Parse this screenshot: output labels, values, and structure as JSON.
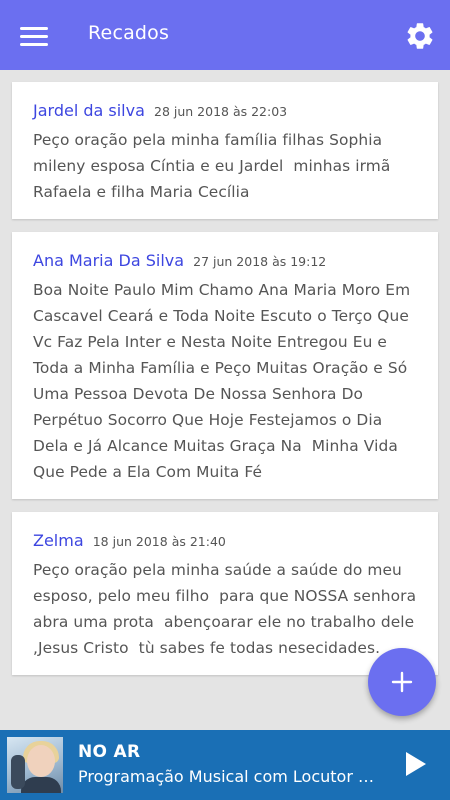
{
  "app_bar": {
    "title": "Recados",
    "menu_icon": "hamburger-menu-icon",
    "settings_icon": "gear-icon"
  },
  "messages": [
    {
      "author": "Jardel da silva",
      "date": "28 jun 2018 às 22:03",
      "text": "Peço oração pela minha família filhas Sophia mileny esposa Cíntia e eu Jardel  minhas irmã Rafaela e filha Maria Cecília"
    },
    {
      "author": "Ana Maria Da Silva",
      "date": "27 jun 2018 às 19:12",
      "text": "Boa Noite Paulo Mim Chamo Ana Maria Moro Em Cascavel Ceará e Toda Noite Escuto o Terço Que Vc Faz Pela Inter e Nesta Noite Entregou Eu e Toda a Minha Família e Peço Muitas Oração e Só Uma Pessoa Devota De Nossa Senhora Do Perpétuo Socorro Que Hoje Festejamos o Dia Dela e Já Alcance Muitas Graça Na  Minha Vida Que Pede a Ela Com Muita Fé"
    },
    {
      "author": "Zelma",
      "date": "18 jun 2018 às 21:40",
      "text": "Peço oração pela minha saúde a saúde do meu esposo, pelo meu filho  para que NOSSA senhora  abra uma prota  abençoarar ele no trabalho dele ,Jesus Cristo  tù sabes fe todas nesecidades."
    }
  ],
  "fab": {
    "icon": "plus-icon"
  },
  "player": {
    "status": "NO AR",
    "program": "Programação Musical com Locutor Virtual",
    "play_icon": "play-icon"
  },
  "colors": {
    "primary": "#6b6ff0",
    "author_link": "#3d46e0",
    "player_bg": "#1a6fb5",
    "background": "#e4e4e4"
  }
}
